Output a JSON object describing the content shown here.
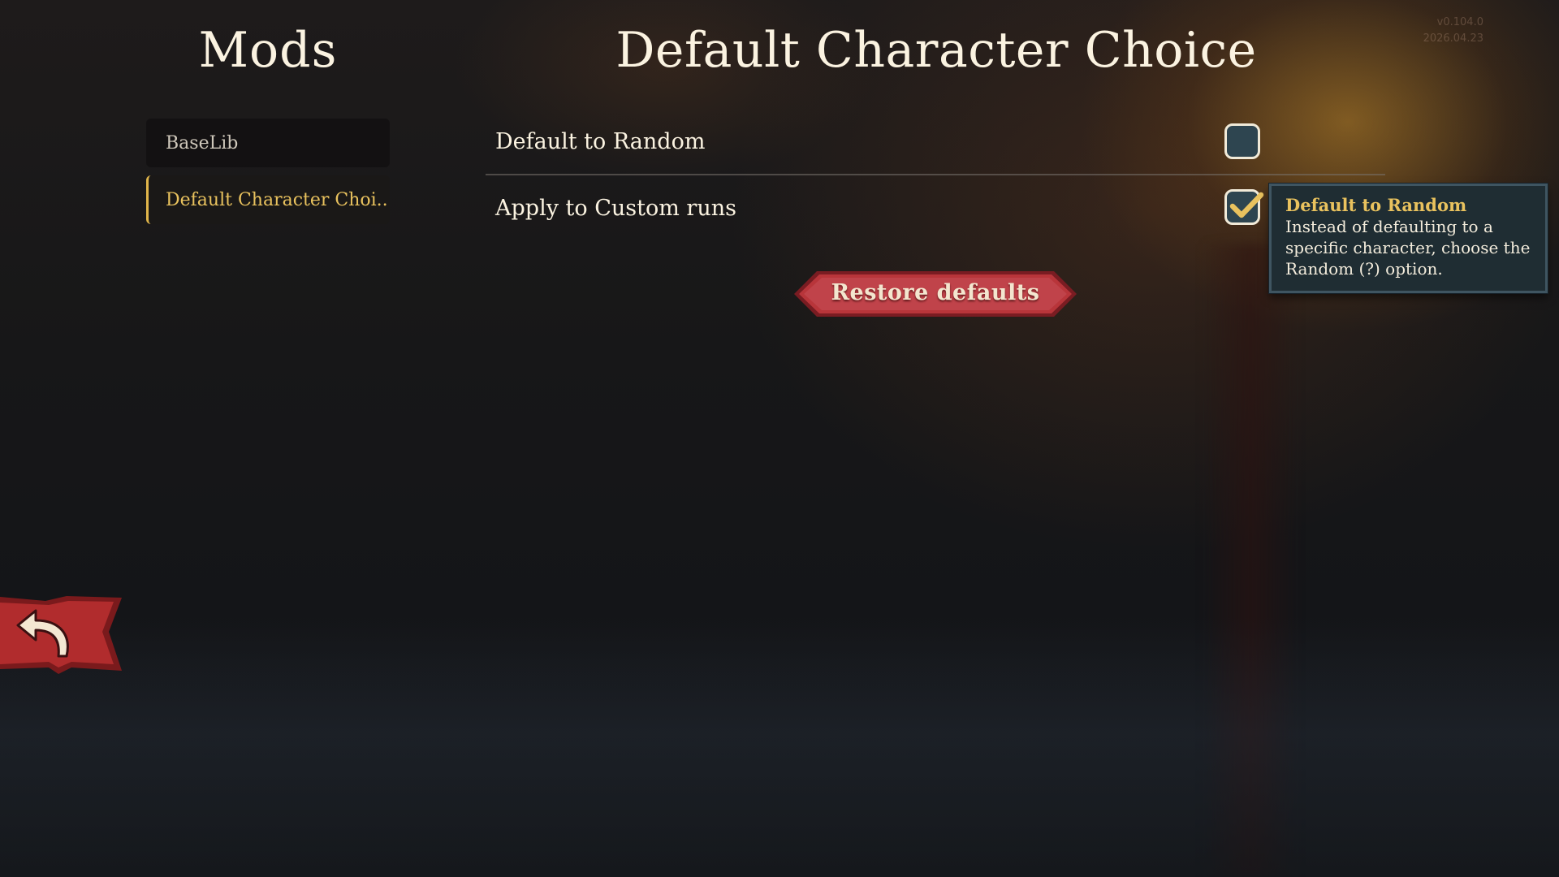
{
  "version": {
    "number": "v0.104.0",
    "date": "2026.04.23"
  },
  "sidebar": {
    "title": "Mods",
    "items": [
      {
        "label": "BaseLib",
        "active": false
      },
      {
        "label": "Default Character Choi..",
        "active": true
      }
    ]
  },
  "main": {
    "title": "Default Character Choice",
    "settings": [
      {
        "label": "Default to Random",
        "checked": false
      },
      {
        "label": "Apply to Custom runs",
        "checked": true
      }
    ],
    "restore_label": "Restore defaults"
  },
  "tooltip": {
    "title": "Default to Random",
    "body_line1": "Instead of defaulting to a",
    "body_line2": "specific character, choose the",
    "body_line3": "Random (?) option."
  },
  "icons": {
    "back": "back-arrow-icon",
    "check": "checkmark-icon"
  },
  "colors": {
    "accent_gold": "#e9c25e",
    "button_red": "#b8353a",
    "checkbox_fill": "#2e4550",
    "tooltip_bg": "#1f2d33"
  }
}
